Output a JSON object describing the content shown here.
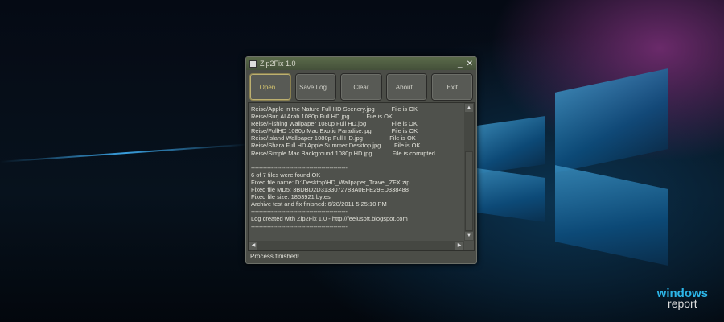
{
  "window": {
    "title": "Zip2Fix 1.0",
    "minimize": "_",
    "close": "✕"
  },
  "toolbar": [
    {
      "label": "Open..."
    },
    {
      "label": "Save Log..."
    },
    {
      "label": "Clear"
    },
    {
      "label": "About..."
    },
    {
      "label": "Exit"
    }
  ],
  "log": {
    "lines": [
      "Reise/Apple in the Nature Full HD Scenery.jpg          File is OK",
      "Reise/Burj Al Arab 1080p Full HD.jpg          File is OK",
      "Reise/Fishing Wallpaper 1080p Full HD.jpg               File is OK",
      "Reise/FullHD 1080p Mac Exotic Paradise.jpg            File is OK",
      "Reise/Island Wallpaper 1080p Full HD.jpg                File is OK",
      "Reise/Shara Full HD Apple Summer Desktop.jpg        File is OK",
      "Reise/Simple Mac Background 1080p HD.jpg            File is corrupted",
      "",
      "------------------------------------------------",
      "6 of 7 files were found OK",
      "Fixed file name: D:\\Desktop\\HD_Wallpaper_Travel_ZFX.zip",
      "Fixed file MD5: 3BDBD2D3133072783A0EFE29ED338488",
      "Fixed file size: 1853921 bytes",
      "Archive test and fix finished: 6/28/2011 5:25:10 PM",
      "------------------------------------------------",
      "Log created with Zip2Fix 1.0 - http://feelusoft.blogspot.com",
      "------------------------------------------------"
    ]
  },
  "status": "Process finished!",
  "watermark": {
    "line1": "windows",
    "line2": "report"
  }
}
